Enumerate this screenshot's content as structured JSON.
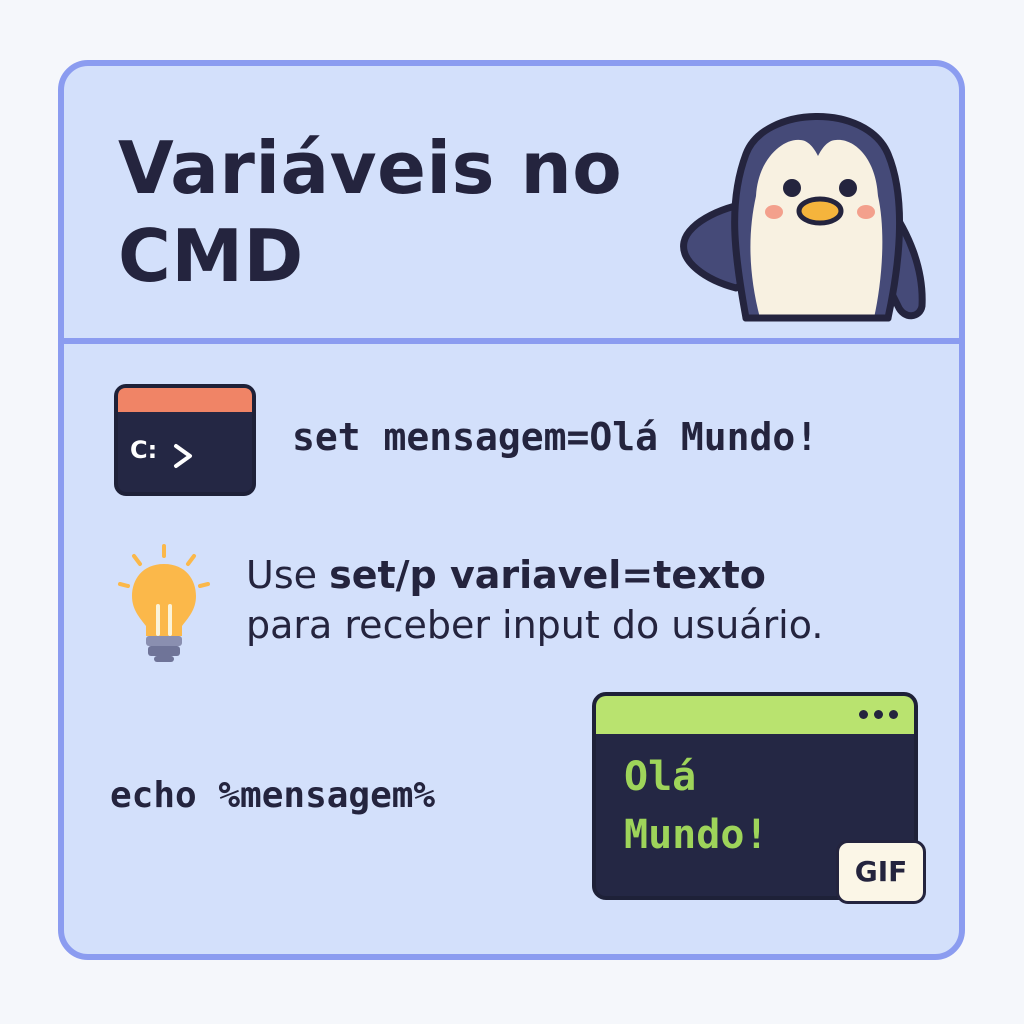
{
  "header": {
    "title": "Variáveis no CMD",
    "mascot_icon": "penguin-waving-icon"
  },
  "rows": {
    "set_command": {
      "icon": "terminal-prompt-icon",
      "icon_text": "C:",
      "command": "set mensagem=Olá Mundo!"
    },
    "tip": {
      "icon": "lightbulb-icon",
      "prefix": "Use ",
      "code": "set/p variavel=texto",
      "suffix": "para receber input do usuário."
    },
    "echo": {
      "command": "echo %mensagem%",
      "output_lines": [
        "Olá",
        "Mundo!"
      ],
      "badge": "GIF"
    }
  },
  "colors": {
    "card_background": "#d3e0fb",
    "card_border": "#8b9cf0",
    "text": "#24243e",
    "terminal_bar": "#f08466",
    "output_bar": "#b9e36f",
    "output_text": "#9ed45a",
    "bulb": "#fbb84a"
  }
}
